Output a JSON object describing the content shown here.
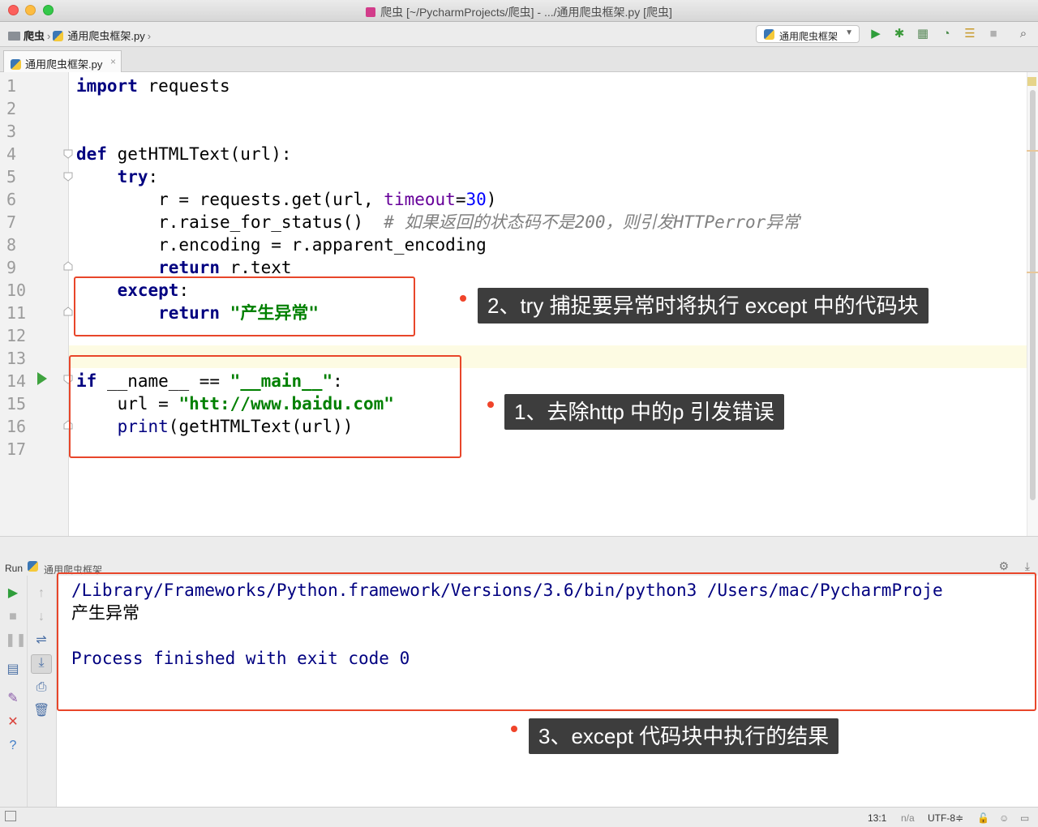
{
  "window": {
    "title": "爬虫 [~/PycharmProjects/爬虫] - .../通用爬虫框架.py [爬虫]"
  },
  "navbar": {
    "project": "爬虫",
    "file": "通用爬虫框架.py",
    "run_config": "通用爬虫框架"
  },
  "tabs": [
    {
      "label": "通用爬虫框架.py",
      "active": true
    }
  ],
  "editor": {
    "line_numbers": [
      "1",
      "2",
      "3",
      "4",
      "5",
      "6",
      "7",
      "8",
      "9",
      "10",
      "11",
      "12",
      "13",
      "14",
      "15",
      "16",
      "17"
    ],
    "current_line": 13
  },
  "callouts": {
    "c1": "1、去除http 中的p 引发错误",
    "c2": "2、try 捕捉要异常时将执行 except 中的代码块",
    "c3": "3、except 代码块中执行的结果"
  },
  "run_panel": {
    "label": "Run",
    "config_name": "通用爬虫框架",
    "console_lines": [
      "/Library/Frameworks/Python.framework/Versions/3.6/bin/python3 /Users/mac/PycharmProje",
      "产生异常",
      "",
      "Process finished with exit code 0"
    ]
  },
  "statusbar": {
    "position": "13:1",
    "line_sep": "n/a",
    "encoding": "UTF-8≑"
  },
  "colors": {
    "keyword": "#000080",
    "string": "#008000",
    "number": "#0000ff",
    "kwarg": "#660099",
    "comment": "#808080",
    "highlight_box": "#e8462a",
    "callout_bg": "#3d3d3d"
  }
}
